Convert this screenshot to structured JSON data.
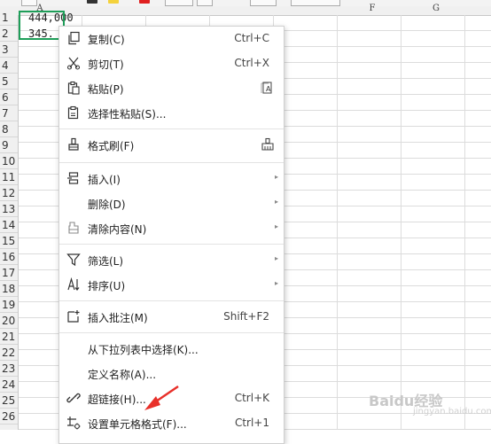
{
  "column_headers": [
    "A",
    "F",
    "G"
  ],
  "row_numbers": [
    "1",
    "2",
    "3",
    "4",
    "5",
    "6",
    "7",
    "8",
    "9",
    "10",
    "11",
    "12",
    "13",
    "14",
    "15",
    "16",
    "17",
    "18",
    "19",
    "20",
    "21",
    "22",
    "23",
    "24",
    "25",
    "26"
  ],
  "cells": [
    {
      "ref": "A1",
      "value": "444,000"
    },
    {
      "ref": "A2",
      "value": "345."
    }
  ],
  "context_menu": {
    "copy": {
      "label": "复制(C)",
      "shortcut": "Ctrl+C",
      "icon": "copy-icon"
    },
    "cut": {
      "label": "剪切(T)",
      "shortcut": "Ctrl+X",
      "icon": "scissors-icon"
    },
    "paste": {
      "label": "粘贴(P)",
      "icon": "clipboard-icon"
    },
    "paste_special": {
      "label": "选择性粘贴(S)...",
      "icon": "clipboard-special-icon"
    },
    "format_painter": {
      "label": "格式刷(F)",
      "icon": "brush-icon"
    },
    "insert": {
      "label": "插入(I)",
      "icon": "insert-icon"
    },
    "delete": {
      "label": "删除(D)"
    },
    "clear": {
      "label": "清除内容(N)",
      "icon": "eraser-icon"
    },
    "filter": {
      "label": "筛选(L)",
      "icon": "filter-icon"
    },
    "sort": {
      "label": "排序(U)",
      "icon": "sort-icon"
    },
    "comment": {
      "label": "插入批注(M)",
      "shortcut": "Shift+F2",
      "icon": "comment-icon"
    },
    "pick_list": {
      "label": "从下拉列表中选择(K)..."
    },
    "define_name": {
      "label": "定义名称(A)..."
    },
    "hyperlink": {
      "label": "超链接(H)...",
      "shortcut": "Ctrl+K",
      "icon": "link-icon"
    },
    "format_cells": {
      "label": "设置单元格格式(F)...",
      "shortcut": "Ctrl+1",
      "icon": "format-cells-icon"
    }
  },
  "annotation": {
    "color": "#e8302a"
  },
  "colors": {
    "selection": "#1e9e59",
    "menu_border": "#d0d0d0"
  },
  "watermark": {
    "text": "Baidu经验",
    "sub": "jingyan.baidu.com"
  }
}
